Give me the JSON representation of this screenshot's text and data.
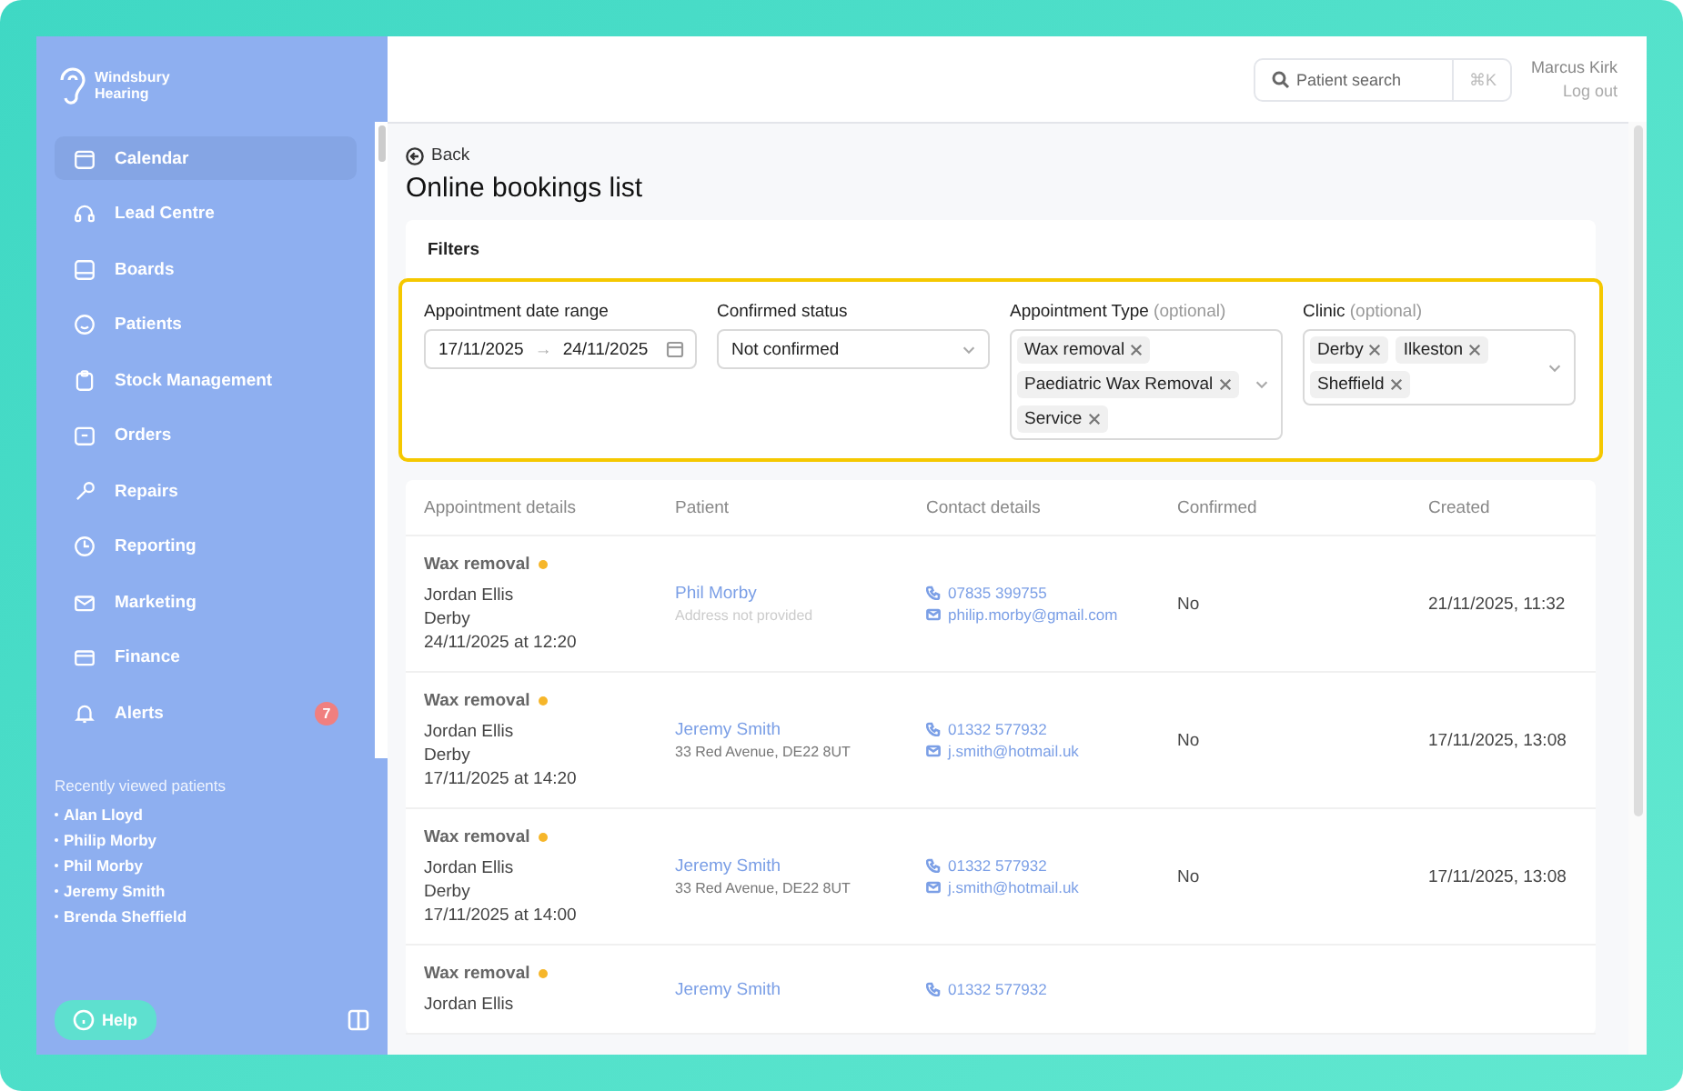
{
  "sidebar": {
    "brand": [
      "Windsbury",
      "Hearing"
    ],
    "items": [
      {
        "label": "Calendar",
        "selected": true
      },
      {
        "label": "Lead Centre",
        "selected": false
      },
      {
        "label": "Boards",
        "selected": false
      },
      {
        "label": "Patients",
        "selected": false
      },
      {
        "label": "Stock Management",
        "selected": false
      },
      {
        "label": "Orders",
        "selected": false
      },
      {
        "label": "Repairs",
        "selected": false
      },
      {
        "label": "Reporting",
        "selected": false
      },
      {
        "label": "Marketing",
        "selected": false
      },
      {
        "label": "Finance",
        "selected": false
      },
      {
        "label": "Alerts",
        "selected": false,
        "badge": "7"
      }
    ],
    "recent_title": "Recently viewed patients",
    "recent": [
      "Alan Lloyd",
      "Philip Morby",
      "Phil Morby",
      "Jeremy Smith",
      "Brenda Sheffield"
    ],
    "help": "Help"
  },
  "topbar": {
    "search_placeholder": "Patient search",
    "shortcut": "⌘K",
    "user": "Marcus Kirk",
    "logout": "Log out"
  },
  "back": "Back",
  "title": "Online bookings list",
  "filters": {
    "title": "Filters",
    "date": {
      "label": "Appointment date range",
      "from": "17/11/2025",
      "arrow": "→",
      "to": "24/11/2025"
    },
    "status": {
      "label": "Confirmed status",
      "value": "Not confirmed"
    },
    "type": {
      "label": "Appointment Type",
      "optional": "(optional)",
      "tags": [
        "Wax removal",
        "Paediatric Wax Removal",
        "Service"
      ]
    },
    "clinic": {
      "label": "Clinic",
      "optional": "(optional)",
      "tags": [
        "Derby",
        "Ilkeston",
        "Sheffield"
      ]
    }
  },
  "table": {
    "columns": [
      "Appointment details",
      "Patient",
      "Contact details",
      "Confirmed",
      "Created"
    ],
    "rows": [
      {
        "type": "Wax removal",
        "flagged": true,
        "details": [
          "Jordan Ellis",
          "Derby",
          "24/11/2025 at 12:20"
        ],
        "patient": "Phil Morby",
        "address": "Address not provided",
        "address_missing": true,
        "phone": "07835 399755",
        "email": "philip.morby@gmail.com",
        "confirmed": "No",
        "created": "21/11/2025, 11:32"
      },
      {
        "type": "Wax removal",
        "flagged": true,
        "details": [
          "Jordan Ellis",
          "Derby",
          "17/11/2025 at 14:20"
        ],
        "patient": "Jeremy Smith",
        "address": "33 Red Avenue, DE22 8UT",
        "address_missing": false,
        "phone": "01332 577932",
        "email": "j.smith@hotmail.uk",
        "confirmed": "No",
        "created": "17/11/2025, 13:08"
      },
      {
        "type": "Wax removal",
        "flagged": true,
        "details": [
          "Jordan Ellis",
          "Derby",
          "17/11/2025 at 14:00"
        ],
        "patient": "Jeremy Smith",
        "address": "33 Red Avenue, DE22 8UT",
        "address_missing": false,
        "phone": "01332 577932",
        "email": "j.smith@hotmail.uk",
        "confirmed": "No",
        "created": "17/11/2025, 13:08"
      },
      {
        "type": "Wax removal",
        "flagged": true,
        "details": [
          "Jordan Ellis"
        ],
        "patient": "Jeremy Smith",
        "phone": "01332 577932"
      }
    ]
  }
}
